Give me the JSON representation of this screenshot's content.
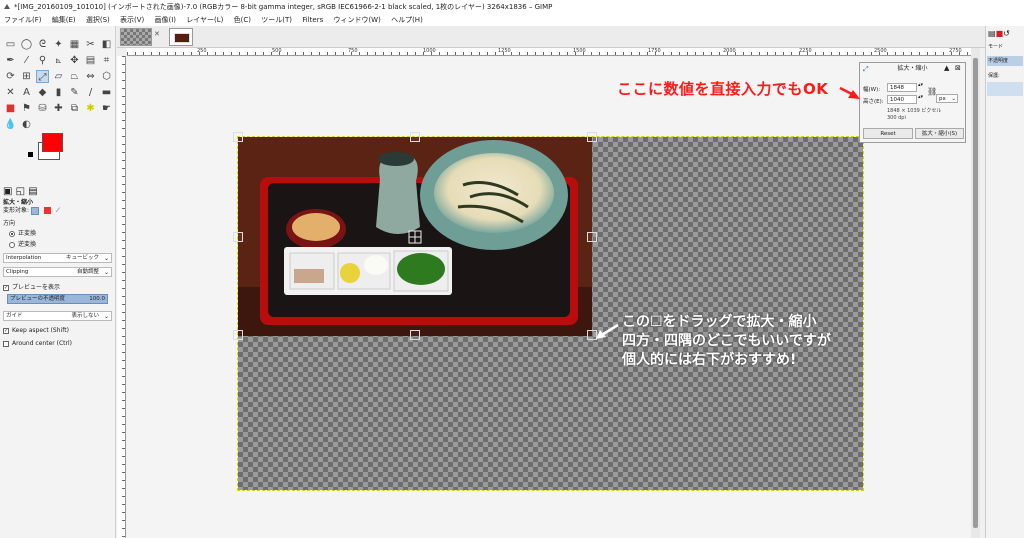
{
  "window": {
    "title": "*[IMG_20160109_101010] (インポートされた画像)-7.0 (RGBカラー 8-bit gamma integer, sRGB IEC61966-2-1 black scaled, 1枚のレイヤー) 3264x1836 – GIMP"
  },
  "menu": [
    "ファイル(F)",
    "編集(E)",
    "選択(S)",
    "表示(V)",
    "画像(I)",
    "レイヤー(L)",
    "色(C)",
    "ツール(T)",
    "Filters",
    "ウィンドウ(W)",
    "ヘルプ(H)"
  ],
  "ruler_top_labels": [
    "250",
    "500",
    "750",
    "1000",
    "1250",
    "1500",
    "1750",
    "2000",
    "2250",
    "2500",
    "2750"
  ],
  "tool_options": {
    "header": "拡大・縮小",
    "transform_label": "変形対象:",
    "direction_label": "方向",
    "direction_forward": "正変換",
    "direction_backward": "逆変換",
    "interpolation_label": "Interpolation",
    "interpolation_value": "キュービック",
    "clipping_label": "Clipping",
    "clipping_value": "自動調整",
    "show_preview": "プレビューを表示",
    "preview_opacity_label": "プレビューの不透明度",
    "preview_opacity_value": "100.0",
    "guides_label": "ガイド",
    "guides_value": "表示しない",
    "keep_aspect": "Keep aspect (Shift)",
    "around_center": "Around center (Ctrl)"
  },
  "scale_dialog": {
    "title": "拡大・縮小",
    "width_label": "幅(W):",
    "width_value": "1848",
    "height_label": "高さ(E):",
    "height_value": "1040",
    "unit": "px",
    "size_info": "1848 × 1039 ピクセル",
    "dpi_info": "300 dpi",
    "reset_label": "Reset",
    "scale_label": "拡大・縮小(S)"
  },
  "right_dock": {
    "mode_label": "モード",
    "opacity_label": "不透明度",
    "lock_label": "保護:"
  },
  "annotations": {
    "direct_input": "ここに数値を直接入力でもOK",
    "drag_line1": "この☐をドラッグで拡大・縮小",
    "drag_line2": "四方・四隅のどこでもいいですが",
    "drag_line3": "個人的には右下がおすすめ!"
  },
  "colors": {
    "foreground": "#ff0000",
    "background": "#ffffff",
    "annotation_red": "#ff1a1a"
  },
  "icons": {
    "gimp": "gimp-icon",
    "close": "close-icon",
    "chain": "chain-link-icon",
    "dialog_scale": "scale-tool-icon"
  }
}
